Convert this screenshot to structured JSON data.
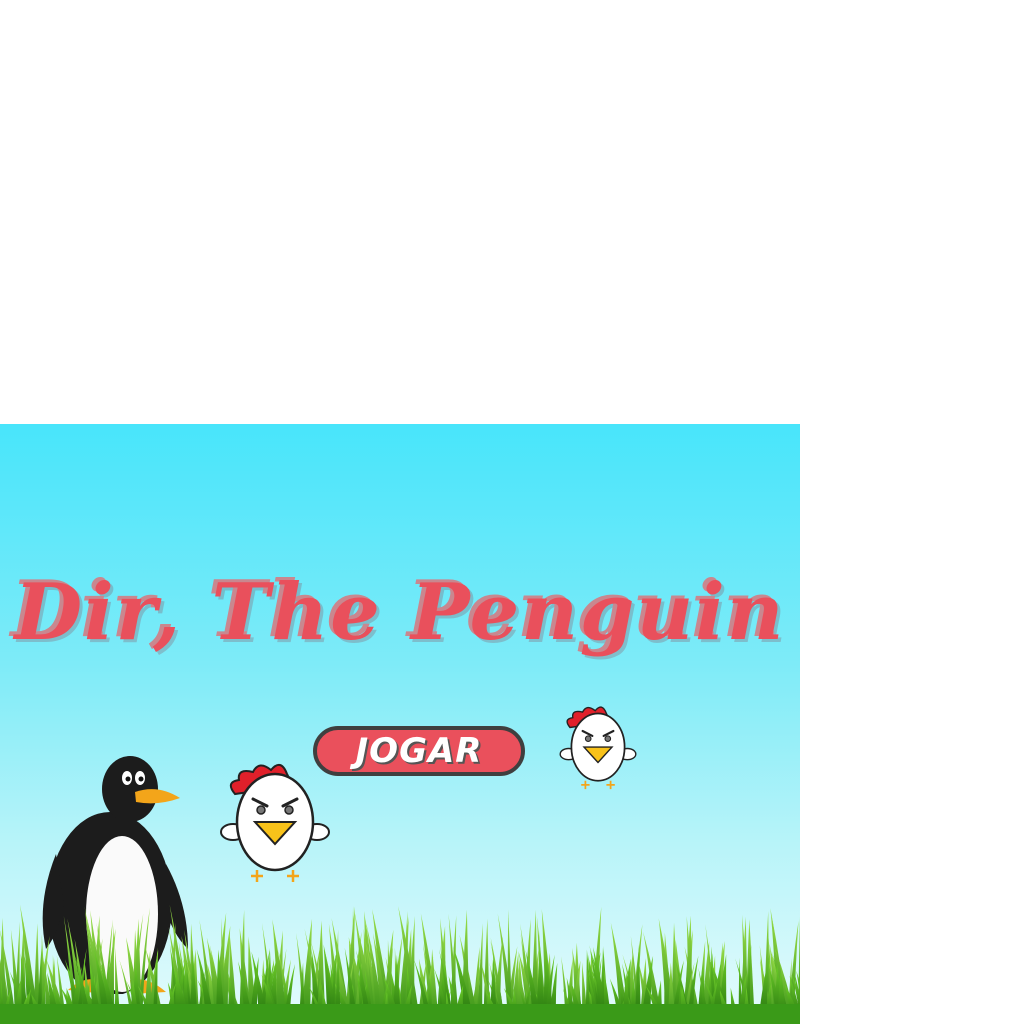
{
  "game": {
    "title": "Dir, The Penguin",
    "play_button_label": "JOGAR"
  },
  "colors": {
    "sky_top": "#48e5fb",
    "sky_bottom": "#e4fbfc",
    "title": "#e9505c",
    "button_fill": "#ea505c",
    "button_border": "#3f3f3f",
    "grass": "#4caf1c"
  },
  "sprites": [
    "penguin",
    "chicken",
    "chicken",
    "grass"
  ]
}
